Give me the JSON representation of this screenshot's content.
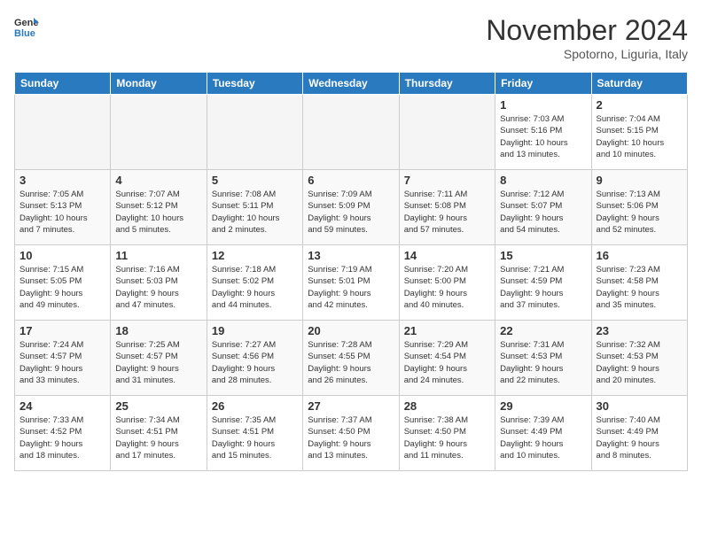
{
  "header": {
    "logo_general": "General",
    "logo_blue": "Blue",
    "month_title": "November 2024",
    "location": "Spotorno, Liguria, Italy"
  },
  "calendar": {
    "days_of_week": [
      "Sunday",
      "Monday",
      "Tuesday",
      "Wednesday",
      "Thursday",
      "Friday",
      "Saturday"
    ],
    "weeks": [
      [
        {
          "day": "",
          "info": ""
        },
        {
          "day": "",
          "info": ""
        },
        {
          "day": "",
          "info": ""
        },
        {
          "day": "",
          "info": ""
        },
        {
          "day": "",
          "info": ""
        },
        {
          "day": "1",
          "info": "Sunrise: 7:03 AM\nSunset: 5:16 PM\nDaylight: 10 hours\nand 13 minutes."
        },
        {
          "day": "2",
          "info": "Sunrise: 7:04 AM\nSunset: 5:15 PM\nDaylight: 10 hours\nand 10 minutes."
        }
      ],
      [
        {
          "day": "3",
          "info": "Sunrise: 7:05 AM\nSunset: 5:13 PM\nDaylight: 10 hours\nand 7 minutes."
        },
        {
          "day": "4",
          "info": "Sunrise: 7:07 AM\nSunset: 5:12 PM\nDaylight: 10 hours\nand 5 minutes."
        },
        {
          "day": "5",
          "info": "Sunrise: 7:08 AM\nSunset: 5:11 PM\nDaylight: 10 hours\nand 2 minutes."
        },
        {
          "day": "6",
          "info": "Sunrise: 7:09 AM\nSunset: 5:09 PM\nDaylight: 9 hours\nand 59 minutes."
        },
        {
          "day": "7",
          "info": "Sunrise: 7:11 AM\nSunset: 5:08 PM\nDaylight: 9 hours\nand 57 minutes."
        },
        {
          "day": "8",
          "info": "Sunrise: 7:12 AM\nSunset: 5:07 PM\nDaylight: 9 hours\nand 54 minutes."
        },
        {
          "day": "9",
          "info": "Sunrise: 7:13 AM\nSunset: 5:06 PM\nDaylight: 9 hours\nand 52 minutes."
        }
      ],
      [
        {
          "day": "10",
          "info": "Sunrise: 7:15 AM\nSunset: 5:05 PM\nDaylight: 9 hours\nand 49 minutes."
        },
        {
          "day": "11",
          "info": "Sunrise: 7:16 AM\nSunset: 5:03 PM\nDaylight: 9 hours\nand 47 minutes."
        },
        {
          "day": "12",
          "info": "Sunrise: 7:18 AM\nSunset: 5:02 PM\nDaylight: 9 hours\nand 44 minutes."
        },
        {
          "day": "13",
          "info": "Sunrise: 7:19 AM\nSunset: 5:01 PM\nDaylight: 9 hours\nand 42 minutes."
        },
        {
          "day": "14",
          "info": "Sunrise: 7:20 AM\nSunset: 5:00 PM\nDaylight: 9 hours\nand 40 minutes."
        },
        {
          "day": "15",
          "info": "Sunrise: 7:21 AM\nSunset: 4:59 PM\nDaylight: 9 hours\nand 37 minutes."
        },
        {
          "day": "16",
          "info": "Sunrise: 7:23 AM\nSunset: 4:58 PM\nDaylight: 9 hours\nand 35 minutes."
        }
      ],
      [
        {
          "day": "17",
          "info": "Sunrise: 7:24 AM\nSunset: 4:57 PM\nDaylight: 9 hours\nand 33 minutes."
        },
        {
          "day": "18",
          "info": "Sunrise: 7:25 AM\nSunset: 4:57 PM\nDaylight: 9 hours\nand 31 minutes."
        },
        {
          "day": "19",
          "info": "Sunrise: 7:27 AM\nSunset: 4:56 PM\nDaylight: 9 hours\nand 28 minutes."
        },
        {
          "day": "20",
          "info": "Sunrise: 7:28 AM\nSunset: 4:55 PM\nDaylight: 9 hours\nand 26 minutes."
        },
        {
          "day": "21",
          "info": "Sunrise: 7:29 AM\nSunset: 4:54 PM\nDaylight: 9 hours\nand 24 minutes."
        },
        {
          "day": "22",
          "info": "Sunrise: 7:31 AM\nSunset: 4:53 PM\nDaylight: 9 hours\nand 22 minutes."
        },
        {
          "day": "23",
          "info": "Sunrise: 7:32 AM\nSunset: 4:53 PM\nDaylight: 9 hours\nand 20 minutes."
        }
      ],
      [
        {
          "day": "24",
          "info": "Sunrise: 7:33 AM\nSunset: 4:52 PM\nDaylight: 9 hours\nand 18 minutes."
        },
        {
          "day": "25",
          "info": "Sunrise: 7:34 AM\nSunset: 4:51 PM\nDaylight: 9 hours\nand 17 minutes."
        },
        {
          "day": "26",
          "info": "Sunrise: 7:35 AM\nSunset: 4:51 PM\nDaylight: 9 hours\nand 15 minutes."
        },
        {
          "day": "27",
          "info": "Sunrise: 7:37 AM\nSunset: 4:50 PM\nDaylight: 9 hours\nand 13 minutes."
        },
        {
          "day": "28",
          "info": "Sunrise: 7:38 AM\nSunset: 4:50 PM\nDaylight: 9 hours\nand 11 minutes."
        },
        {
          "day": "29",
          "info": "Sunrise: 7:39 AM\nSunset: 4:49 PM\nDaylight: 9 hours\nand 10 minutes."
        },
        {
          "day": "30",
          "info": "Sunrise: 7:40 AM\nSunset: 4:49 PM\nDaylight: 9 hours\nand 8 minutes."
        }
      ]
    ]
  }
}
